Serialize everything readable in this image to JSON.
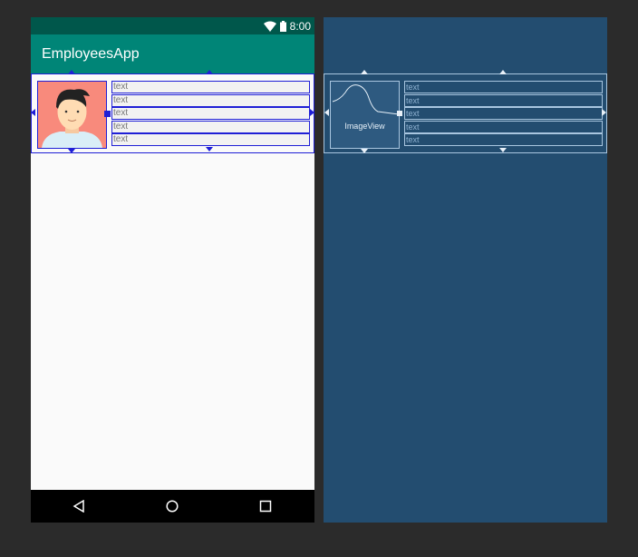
{
  "status_bar": {
    "time": "8:00"
  },
  "app_bar": {
    "title": "EmployeesApp"
  },
  "item": {
    "text_views": [
      "text",
      "text",
      "text",
      "text",
      "text"
    ]
  },
  "blueprint": {
    "image_view_label": "ImageView",
    "text_views": [
      "text",
      "text",
      "text",
      "text",
      "text"
    ]
  },
  "navigation": {
    "back_icon": "back-triangle-icon",
    "home_icon": "home-circle-icon",
    "recents_icon": "recents-square-icon"
  },
  "colors": {
    "status_bar": "#00574b",
    "app_bar": "#008577",
    "selection": "#1f1fd6",
    "blueprint_bg": "#234d70",
    "avatar_bg": "#f88a7c"
  }
}
